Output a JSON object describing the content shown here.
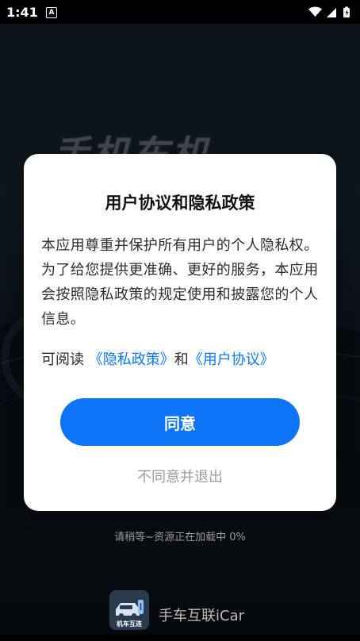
{
  "status_bar": {
    "time": "1:41",
    "notification_badge": "A"
  },
  "background": {
    "watermark_text": "手机车机",
    "loading_text": "请稍等~资源正在加载中 0%"
  },
  "brand": {
    "logo_text": "机车互连",
    "app_name": "手车互联iCar"
  },
  "dialog": {
    "title": "用户协议和隐私政策",
    "body": "本应用尊重并保护所有用户的个人隐私权。为了给您提供更准确、更好的服务，本应用会按照隐私政策的规定使用和披露您的个人信息。",
    "links_prefix": "可阅读",
    "privacy_policy_link": "《隐私政策》",
    "links_conjunction": "和",
    "user_agreement_link": "《用户协议》",
    "agree_button": "同意",
    "decline_button": "不同意并退出"
  },
  "icons": {
    "wifi": "wifi-icon",
    "signal": "signal-icon",
    "battery": "battery-icon"
  },
  "colors": {
    "primary": "#0d74f6",
    "link": "#0b78ff",
    "dialog_bg": "#ffffff",
    "muted_text": "#9c9c9c"
  }
}
